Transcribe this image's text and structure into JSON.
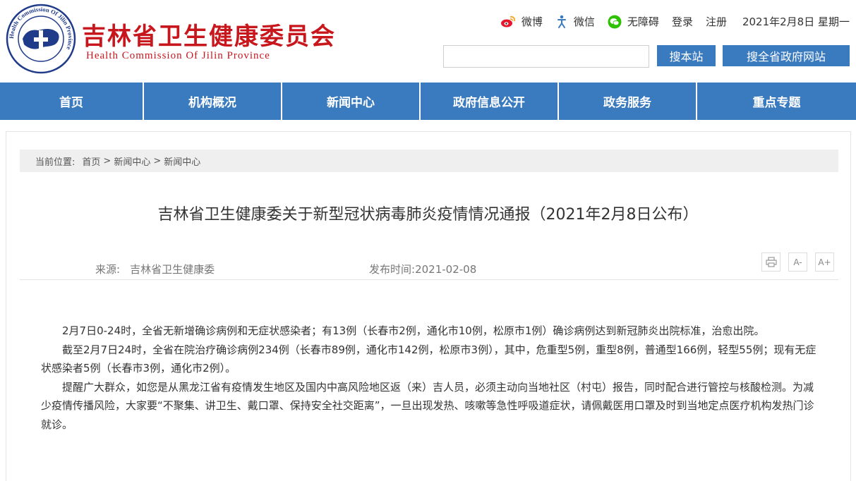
{
  "header": {
    "site_title": "吉林省卫生健康委员会",
    "site_subtitle": "Health Commission Of Jilin Province",
    "logo_text": "Health Commission Of Jilin Province",
    "links": {
      "weibo": "微博",
      "wechat": "微信",
      "accessibility": "无障碍",
      "login": "登录",
      "register": "注册"
    },
    "date": "2021年2月8日 星期一",
    "search": {
      "value": "",
      "placeholder": ""
    },
    "btn_site": "搜本站",
    "btn_gov": "搜全省政府网站"
  },
  "nav": {
    "items": [
      {
        "label": "首页"
      },
      {
        "label": "机构概况"
      },
      {
        "label": "新闻中心"
      },
      {
        "label": "政府信息公开"
      },
      {
        "label": "政务服务"
      },
      {
        "label": "重点专题"
      }
    ]
  },
  "breadcrumb": {
    "label": "当前位置:",
    "items": [
      "首页",
      "新闻中心",
      "新闻中心"
    ],
    "separator": ">"
  },
  "article": {
    "title": "吉林省卫生健康委关于新型冠状病毒肺炎疫情情况通报（2021年2月8日公布）",
    "source_label": "来源:",
    "source": "吉林省卫生健康委",
    "date_label": "发布时间:",
    "date": "2021-02-08",
    "tools": {
      "minus": "A-",
      "plus": "A+"
    },
    "paragraphs": [
      "2月7日0-24时，全省无新增确诊病例和无症状感染者；有13例（长春市2例，通化市10例，松原市1例）确诊病例达到新冠肺炎出院标准，治愈出院。",
      "截至2月7日24时，全省在院治疗确诊病例234例（长春市89例，通化市142例，松原市3例），其中，危重型5例，重型8例，普通型166例，轻型55例；现有无症状感染者5例（长春市3例，通化市2例）。",
      "提醒广大群众，如您是从黑龙江省有疫情发生地区及国内中高风险地区返（来）吉人员，必须主动向当地社区（村屯）报告，同时配合进行管控与核酸检测。为减少疫情传播风险，大家要“不聚集、讲卫生、戴口罩、保持安全社交距离”，一旦出现发热、咳嗽等急性呼吸道症状，请佩戴医用口罩及时到当地定点医疗机构发热门诊就诊。"
    ]
  },
  "colors": {
    "brand_red": "#c8161d",
    "nav_blue": "#3a7abf"
  }
}
